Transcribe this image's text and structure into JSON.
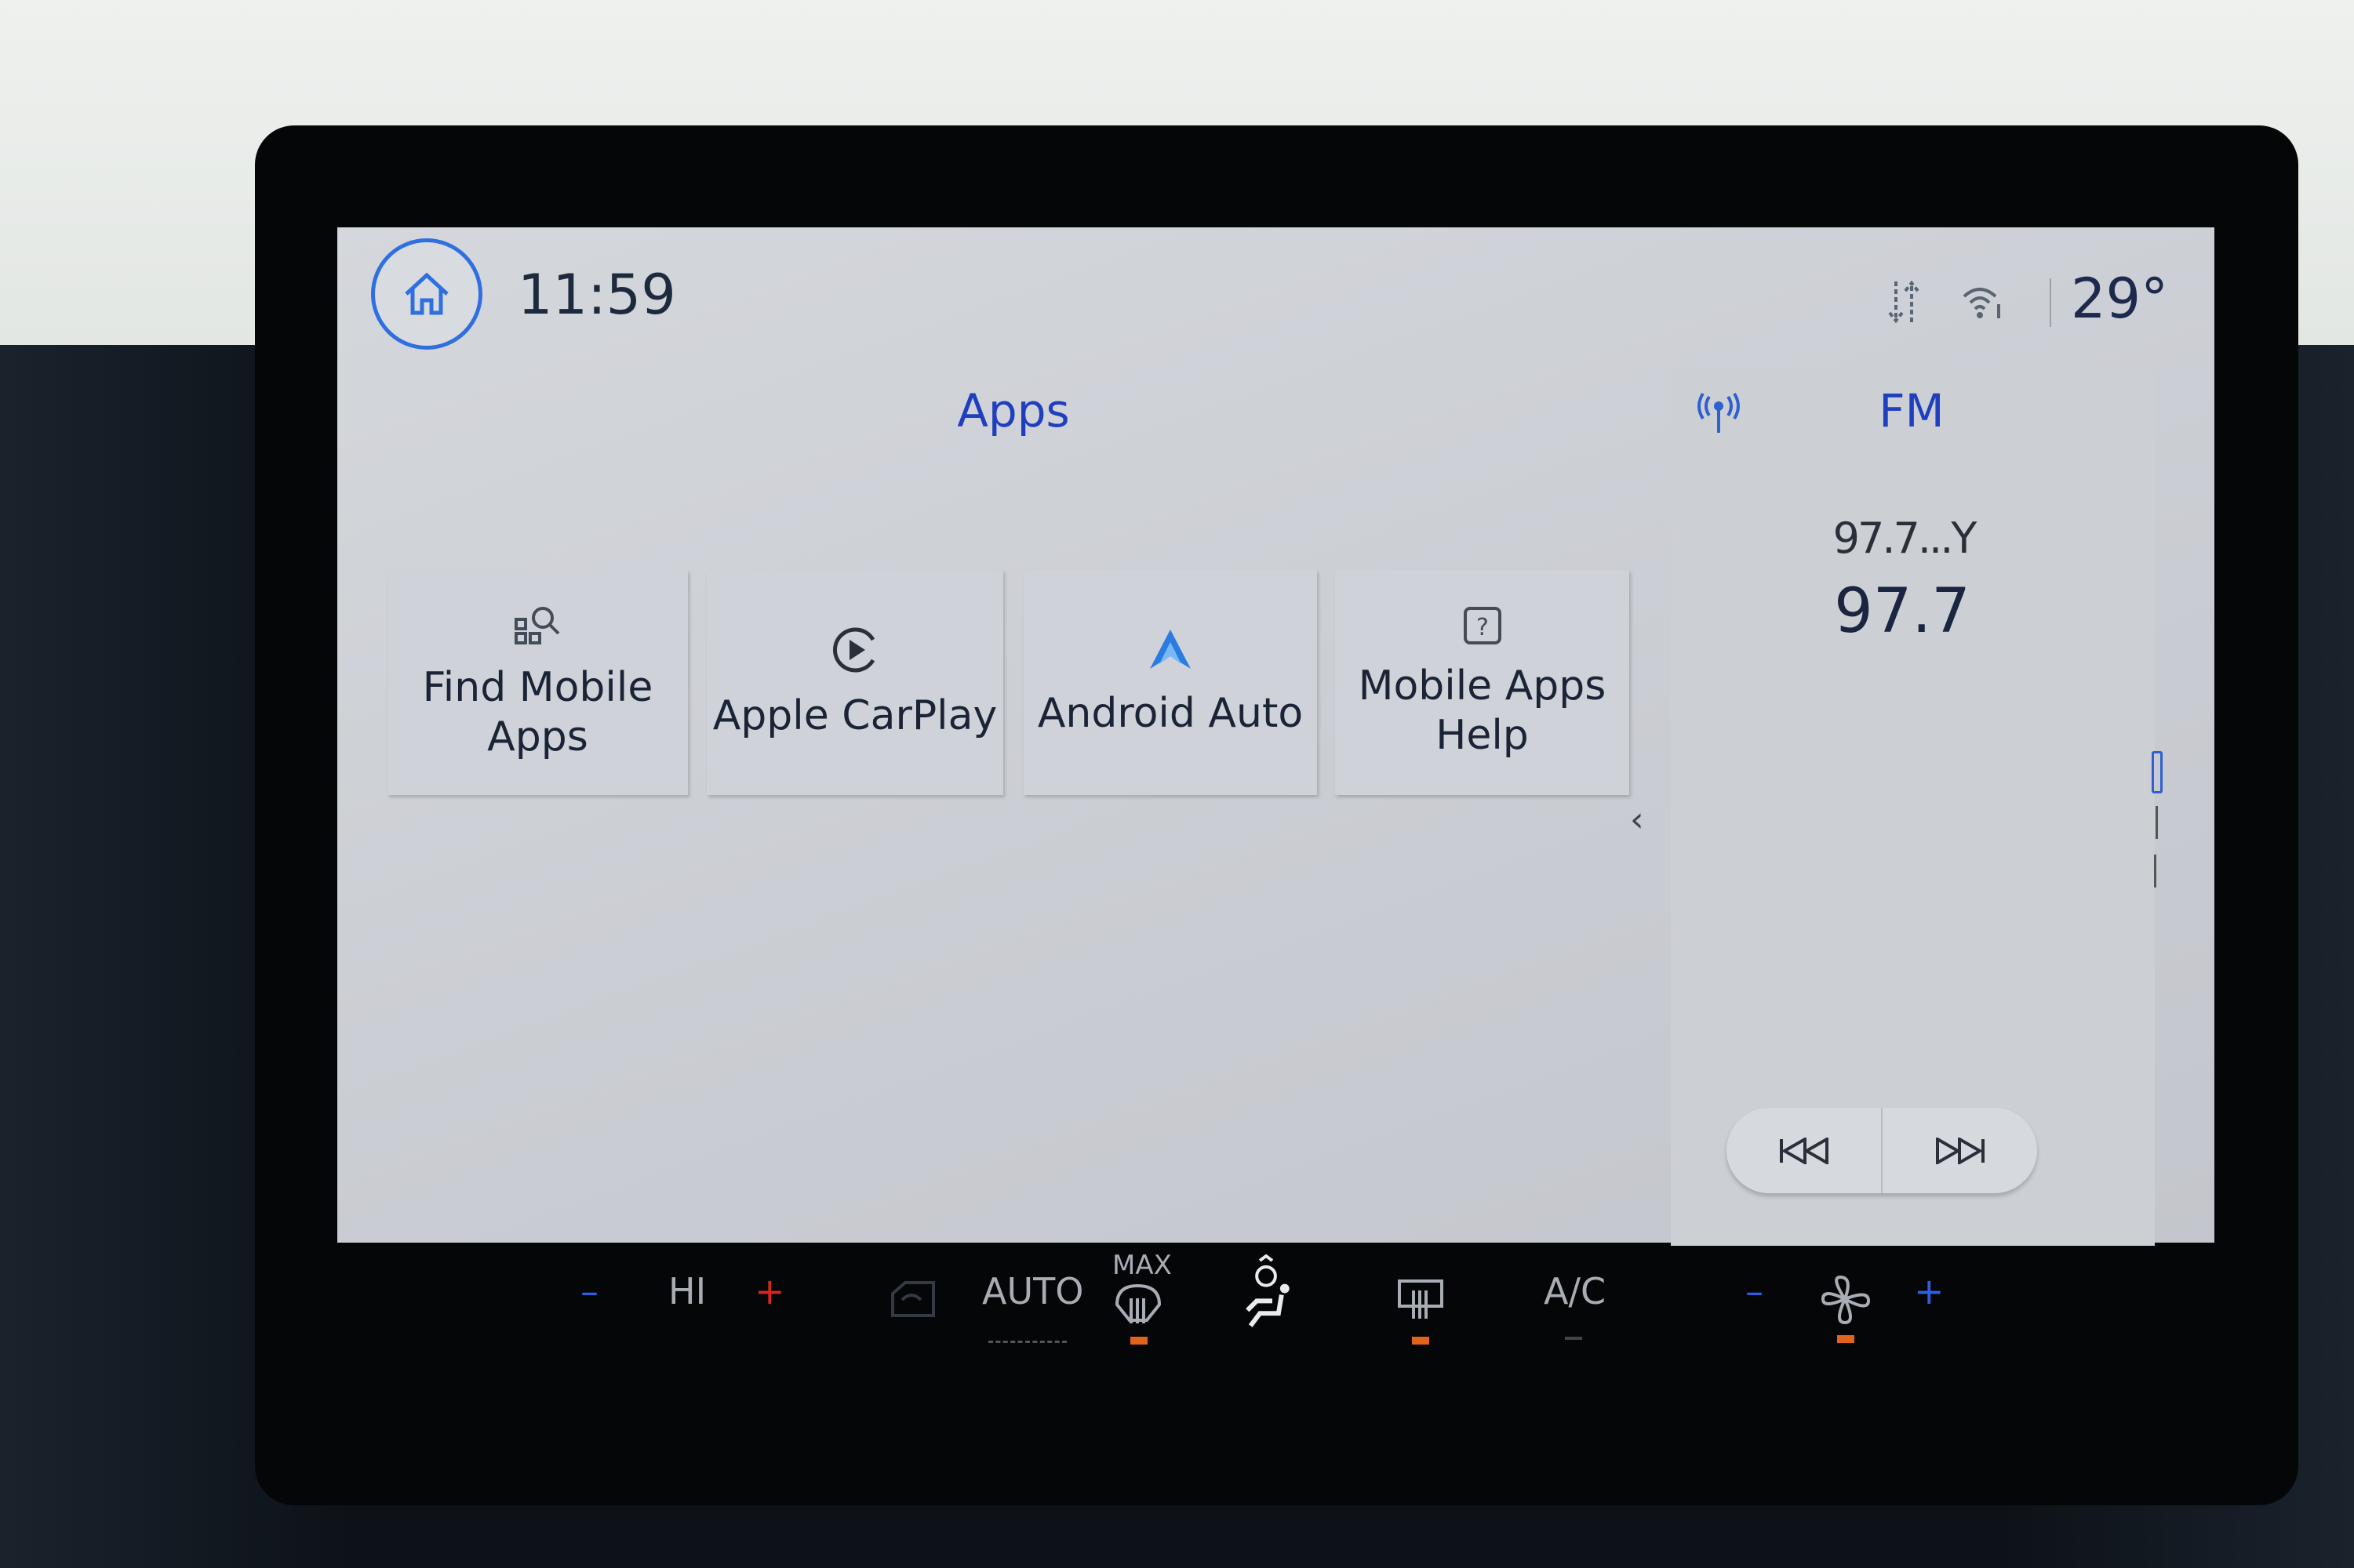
{
  "header": {
    "time": "11:59",
    "temperature": "29°",
    "icons": [
      "home-icon",
      "data-transfer-icon",
      "wifi-info-icon"
    ]
  },
  "apps": {
    "title": "Apps",
    "tiles": [
      {
        "label_line1": "Find Mobile",
        "label_line2": "Apps",
        "icon": "find-apps-icon"
      },
      {
        "label_line1": "Apple CarPlay",
        "label_line2": "",
        "icon": "carplay-icon"
      },
      {
        "label_line1": "Android Auto",
        "label_line2": "",
        "icon": "android-auto-icon"
      },
      {
        "label_line1": "Mobile Apps",
        "label_line2": "Help",
        "icon": "help-icon"
      }
    ]
  },
  "radio": {
    "band": "FM",
    "station_name": "97.7...Y",
    "frequency": "97.7",
    "icon": "antenna-icon"
  },
  "climate": {
    "temp_setting": "HI",
    "auto": "AUTO",
    "max": "MAX",
    "ac": "A/C",
    "minus": "–",
    "plus": "+"
  },
  "colors": {
    "accent": "#1f3fbf",
    "indicator": "#e2631c",
    "minus": "#2f5fe0",
    "plus": "#d8281c"
  }
}
